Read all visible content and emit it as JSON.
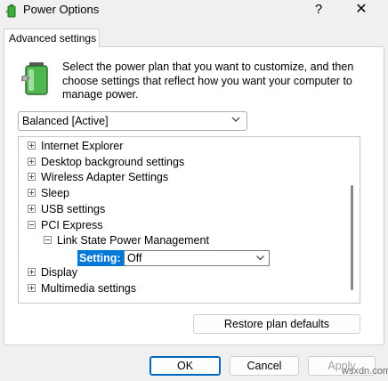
{
  "window": {
    "title": "Power Options",
    "help_label": "?",
    "close_label": "✕",
    "icon": "power-options-icon"
  },
  "tab": {
    "label": "Advanced settings"
  },
  "description": "Select the power plan that you want to customize, and then choose settings that reflect how you want your computer to manage power.",
  "plan_select": {
    "value": "Balanced [Active]",
    "icon": "chevron-down-icon"
  },
  "tree": {
    "items": [
      {
        "label": "Internet Explorer",
        "expanded": false
      },
      {
        "label": "Desktop background settings",
        "expanded": false
      },
      {
        "label": "Wireless Adapter Settings",
        "expanded": false
      },
      {
        "label": "Sleep",
        "expanded": false
      },
      {
        "label": "USB settings",
        "expanded": false
      },
      {
        "label": "PCI Express",
        "expanded": true
      },
      {
        "label": "Link State Power Management",
        "expanded": true
      },
      {
        "label": "Display",
        "expanded": false
      },
      {
        "label": "Multimedia settings",
        "expanded": false
      }
    ],
    "setting": {
      "label": "Setting:",
      "value": "Off"
    }
  },
  "buttons": {
    "restore": "Restore plan defaults",
    "ok": "OK",
    "cancel": "Cancel",
    "apply": "Apply"
  },
  "watermark": "wsxdn.com",
  "colors": {
    "selection": "#0078d7",
    "default_button_border": "#0067c0"
  }
}
